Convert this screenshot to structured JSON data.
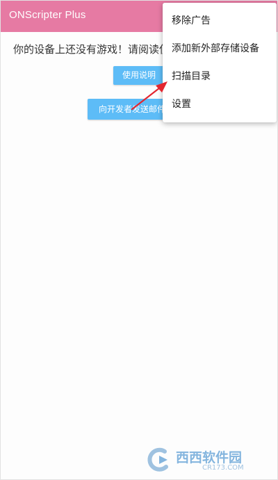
{
  "app": {
    "title": "ONScripter Plus"
  },
  "main": {
    "message": "你的设备上还没有游戏！请阅读使用说明",
    "help_button": "使用说明",
    "mail_button": "向开发者发送邮件"
  },
  "menu": {
    "items": [
      {
        "label": "移除广告"
      },
      {
        "label": "添加新外部存储设备"
      },
      {
        "label": "扫描目录"
      },
      {
        "label": "设置"
      }
    ]
  },
  "annotation": {
    "arrow_color": "#e3262f",
    "points_to": "扫描目录"
  },
  "watermark": {
    "brand": "西西软件园",
    "url": "CR173.COM",
    "color": "#6fa9d9"
  },
  "colors": {
    "appbar": "#e67aa3",
    "button": "#5dbcf7",
    "menu_bg": "#ffffff"
  }
}
